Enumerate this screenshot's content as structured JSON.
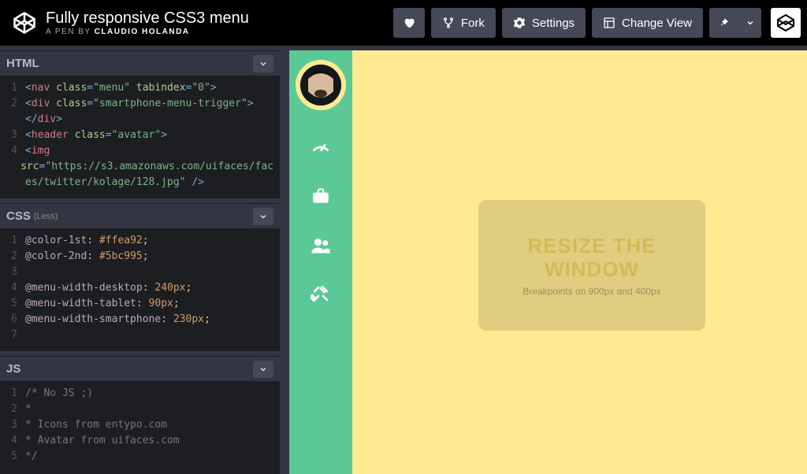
{
  "header": {
    "title": "Fully responsive CSS3 menu",
    "byline_prefix": "A PEN BY ",
    "author": "Claudio Holanda",
    "buttons": {
      "fork": "Fork",
      "settings": "Settings",
      "change_view": "Change View"
    }
  },
  "editors": {
    "html": {
      "label": "HTML",
      "lines": [
        {
          "n": "1",
          "frags": [
            {
              "t": "<",
              "c": "tok-op"
            },
            {
              "t": "nav",
              "c": "tok-tag"
            },
            {
              "t": " class",
              "c": "tok-attr"
            },
            {
              "t": "=",
              "c": "tok-op"
            },
            {
              "t": "\"menu\"",
              "c": "tok-str"
            },
            {
              "t": " tabindex",
              "c": "tok-attr"
            },
            {
              "t": "=",
              "c": "tok-op"
            },
            {
              "t": "\"0\"",
              "c": "tok-str"
            },
            {
              "t": ">",
              "c": "tok-op"
            }
          ]
        },
        {
          "n": "2",
          "frags": [
            {
              "t": "  ",
              "c": "tok-plain"
            },
            {
              "t": "<",
              "c": "tok-op"
            },
            {
              "t": "div",
              "c": "tok-tag"
            },
            {
              "t": " class",
              "c": "tok-attr"
            },
            {
              "t": "=",
              "c": "tok-op"
            },
            {
              "t": "\"smartphone-menu-trigger\"",
              "c": "tok-str"
            },
            {
              "t": ">",
              "c": "tok-op"
            }
          ]
        },
        {
          "n": " ",
          "frags": [
            {
              "t": "</",
              "c": "tok-op"
            },
            {
              "t": "div",
              "c": "tok-tag"
            },
            {
              "t": ">",
              "c": "tok-op"
            }
          ]
        },
        {
          "n": "3",
          "frags": [
            {
              "t": "  ",
              "c": "tok-plain"
            },
            {
              "t": "<",
              "c": "tok-op"
            },
            {
              "t": "header",
              "c": "tok-tag"
            },
            {
              "t": " class",
              "c": "tok-attr"
            },
            {
              "t": "=",
              "c": "tok-op"
            },
            {
              "t": "\"avatar\"",
              "c": "tok-str"
            },
            {
              "t": ">",
              "c": "tok-op"
            }
          ]
        },
        {
          "n": "4",
          "frags": [
            {
              "t": "    ",
              "c": "tok-plain"
            },
            {
              "t": "<",
              "c": "tok-op"
            },
            {
              "t": "img",
              "c": "tok-tag"
            }
          ]
        },
        {
          "n": " ",
          "frags": [
            {
              "t": "src",
              "c": "tok-attr"
            },
            {
              "t": "=",
              "c": "tok-op"
            },
            {
              "t": "\"https://s3.amazonaws.com/uifaces/fac",
              "c": "tok-str"
            }
          ]
        },
        {
          "n": " ",
          "frags": [
            {
              "t": "es/twitter/kolage/128.jpg\"",
              "c": "tok-str"
            },
            {
              "t": " />",
              "c": "tok-op"
            }
          ]
        }
      ]
    },
    "css": {
      "label": "CSS",
      "paren": "(Less)",
      "lines": [
        {
          "n": "1",
          "frags": [
            {
              "t": "@color-1st",
              "c": "tok-var"
            },
            {
              "t": ": ",
              "c": "tok-plain"
            },
            {
              "t": "#ffea92",
              "c": "tok-num"
            },
            {
              "t": ";",
              "c": "tok-plain"
            }
          ]
        },
        {
          "n": "2",
          "frags": [
            {
              "t": "@color-2nd",
              "c": "tok-var"
            },
            {
              "t": ": ",
              "c": "tok-plain"
            },
            {
              "t": "#5bc995",
              "c": "tok-num"
            },
            {
              "t": ";",
              "c": "tok-plain"
            }
          ]
        },
        {
          "n": "3",
          "frags": [
            {
              "t": "",
              "c": "tok-plain"
            }
          ]
        },
        {
          "n": "4",
          "frags": [
            {
              "t": "@menu-width-desktop",
              "c": "tok-var"
            },
            {
              "t": ": ",
              "c": "tok-plain"
            },
            {
              "t": "240px",
              "c": "tok-num"
            },
            {
              "t": ";",
              "c": "tok-plain"
            }
          ]
        },
        {
          "n": "5",
          "frags": [
            {
              "t": "@menu-width-tablet",
              "c": "tok-var"
            },
            {
              "t": ": ",
              "c": "tok-plain"
            },
            {
              "t": "90px",
              "c": "tok-num"
            },
            {
              "t": ";",
              "c": "tok-plain"
            }
          ]
        },
        {
          "n": "6",
          "frags": [
            {
              "t": "@menu-width-smartphone",
              "c": "tok-var"
            },
            {
              "t": ": ",
              "c": "tok-plain"
            },
            {
              "t": "230px",
              "c": "tok-num"
            },
            {
              "t": ";",
              "c": "tok-plain"
            }
          ]
        },
        {
          "n": "7",
          "frags": [
            {
              "t": "",
              "c": "tok-plain"
            }
          ]
        }
      ]
    },
    "js": {
      "label": "JS",
      "lines": [
        {
          "n": "1",
          "frags": [
            {
              "t": "/* No JS ;)",
              "c": "tok-cmt"
            }
          ]
        },
        {
          "n": "2",
          "frags": [
            {
              "t": " *",
              "c": "tok-cmt"
            }
          ]
        },
        {
          "n": "3",
          "frags": [
            {
              "t": " * Icons from entypo.com",
              "c": "tok-cmt"
            }
          ]
        },
        {
          "n": "4",
          "frags": [
            {
              "t": " * Avatar from uifaces.com",
              "c": "tok-cmt"
            }
          ]
        },
        {
          "n": "5",
          "frags": [
            {
              "t": " */",
              "c": "tok-cmt"
            }
          ]
        }
      ]
    }
  },
  "preview": {
    "resize": {
      "big_line1": "RESIZE THE",
      "big_line2": "WINDOW",
      "sub": "Breakpoints on 900px and 400px"
    },
    "icons": [
      "gauge-icon",
      "briefcase-icon",
      "users-icon",
      "tools-icon"
    ]
  }
}
